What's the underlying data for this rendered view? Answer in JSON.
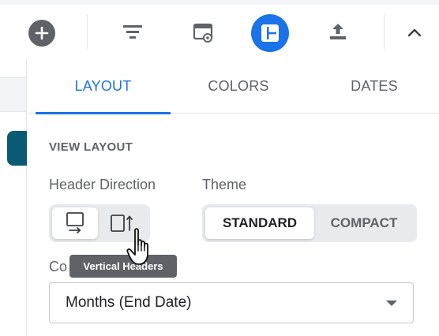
{
  "toolbar": {
    "buttons": [
      {
        "icon": "plus-circle-icon"
      },
      {
        "icon": "filter-icon"
      },
      {
        "icon": "view-settings-icon"
      },
      {
        "icon": "layout-icon",
        "active": true
      },
      {
        "icon": "export-icon"
      },
      {
        "icon": "chevron-up-icon"
      }
    ]
  },
  "panel": {
    "tabs": [
      {
        "label": "LAYOUT",
        "active": true
      },
      {
        "label": "COLORS"
      },
      {
        "label": "DATES"
      }
    ],
    "section_title": "VIEW LAYOUT",
    "header_direction": {
      "label": "Header Direction",
      "options": [
        "horizontal-headers",
        "vertical-headers"
      ],
      "selected": "horizontal-headers"
    },
    "theme": {
      "label": "Theme",
      "options": [
        "STANDARD",
        "COMPACT"
      ],
      "selected": "STANDARD"
    },
    "columns": {
      "label_visible": "Co",
      "select_value": "Months (End Date)"
    },
    "tooltip": "Vertical Headers"
  },
  "colors": {
    "accent": "#1a73e8",
    "left_pill": "#0a5a73",
    "tooltip_bg": "#5f6368"
  }
}
